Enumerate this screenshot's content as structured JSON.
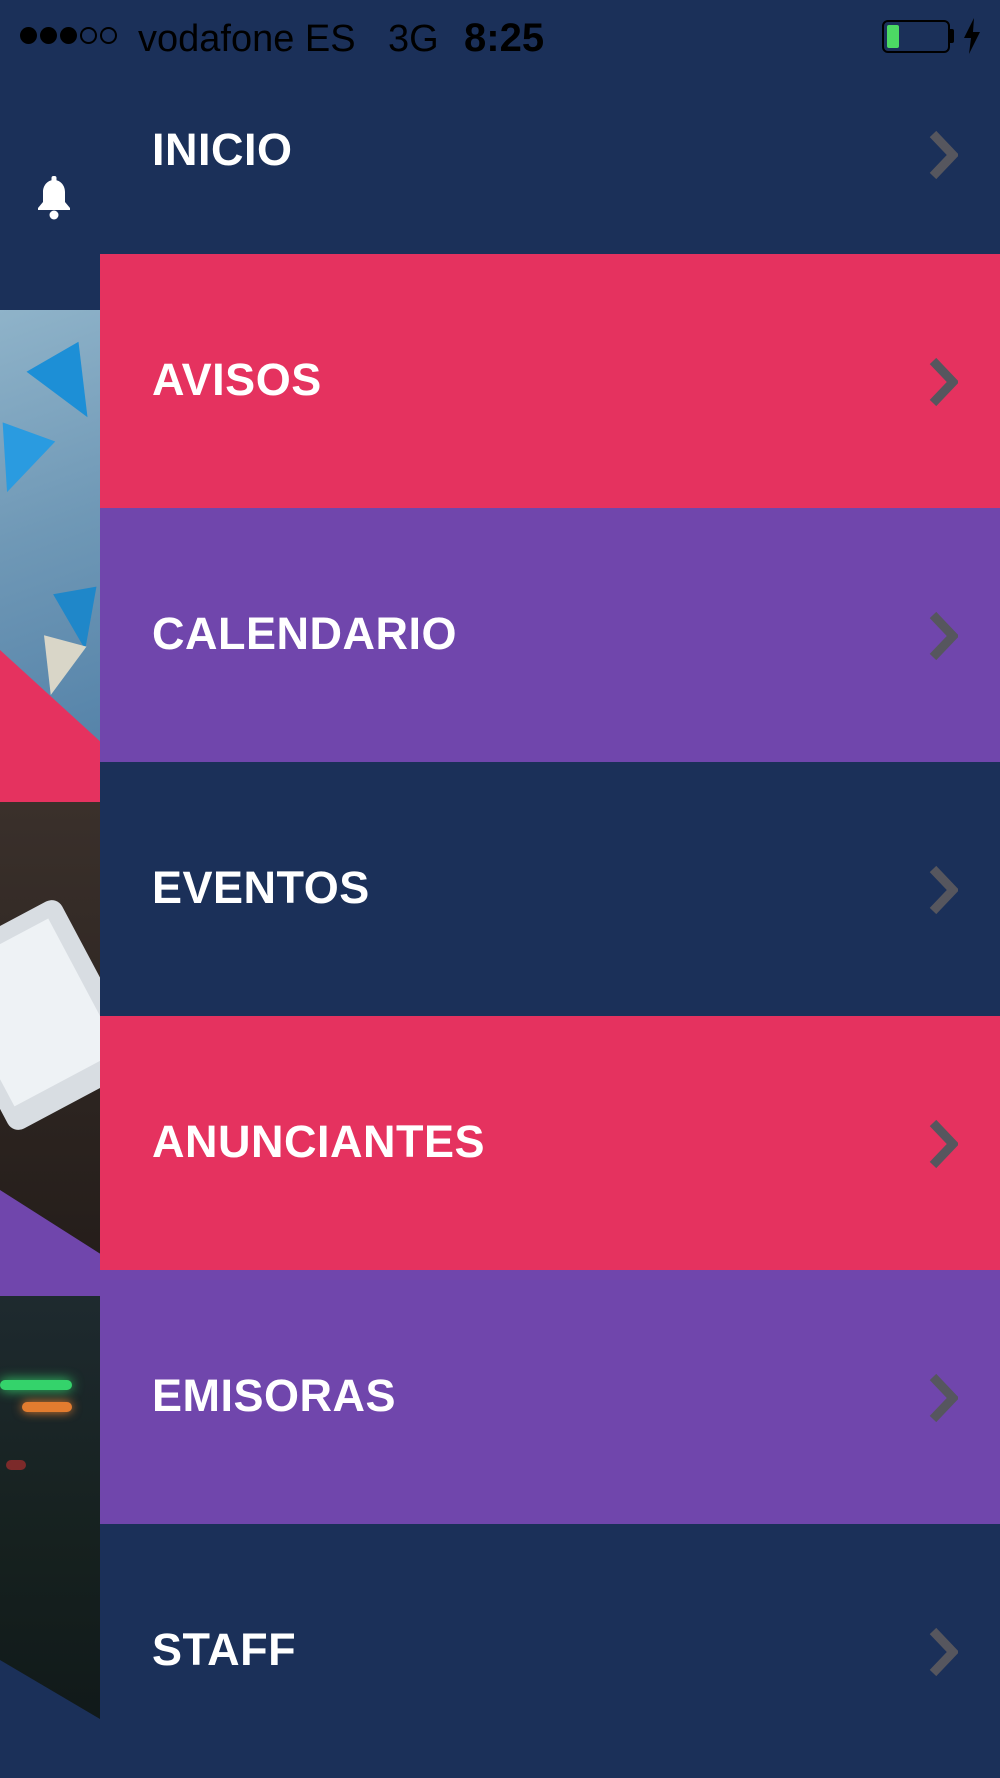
{
  "status_bar": {
    "signal_dots": "●●●○○",
    "carrier": "vodafone ES",
    "network": "3G",
    "time": "8:25",
    "battery_level": 0.2,
    "charging": true
  },
  "background_app": {
    "notification_icon": "bell-icon"
  },
  "menu": {
    "items": [
      {
        "label": "INICIO",
        "color": "#1b3059"
      },
      {
        "label": "AVISOS",
        "color": "#e5325f"
      },
      {
        "label": "CALENDARIO",
        "color": "#7046ac"
      },
      {
        "label": "EVENTOS",
        "color": "#1b3059"
      },
      {
        "label": "ANUNCIANTES",
        "color": "#e5325f"
      },
      {
        "label": "EMISORAS",
        "color": "#7046ac"
      },
      {
        "label": "STAFF",
        "color": "#1b3059"
      }
    ],
    "chevron_icon": "chevron-right-icon",
    "chevron_color": "#56565e"
  },
  "colors": {
    "navy": "#1b3059",
    "pink": "#e5325f",
    "purple": "#7046ac",
    "text": "#ffffff"
  }
}
